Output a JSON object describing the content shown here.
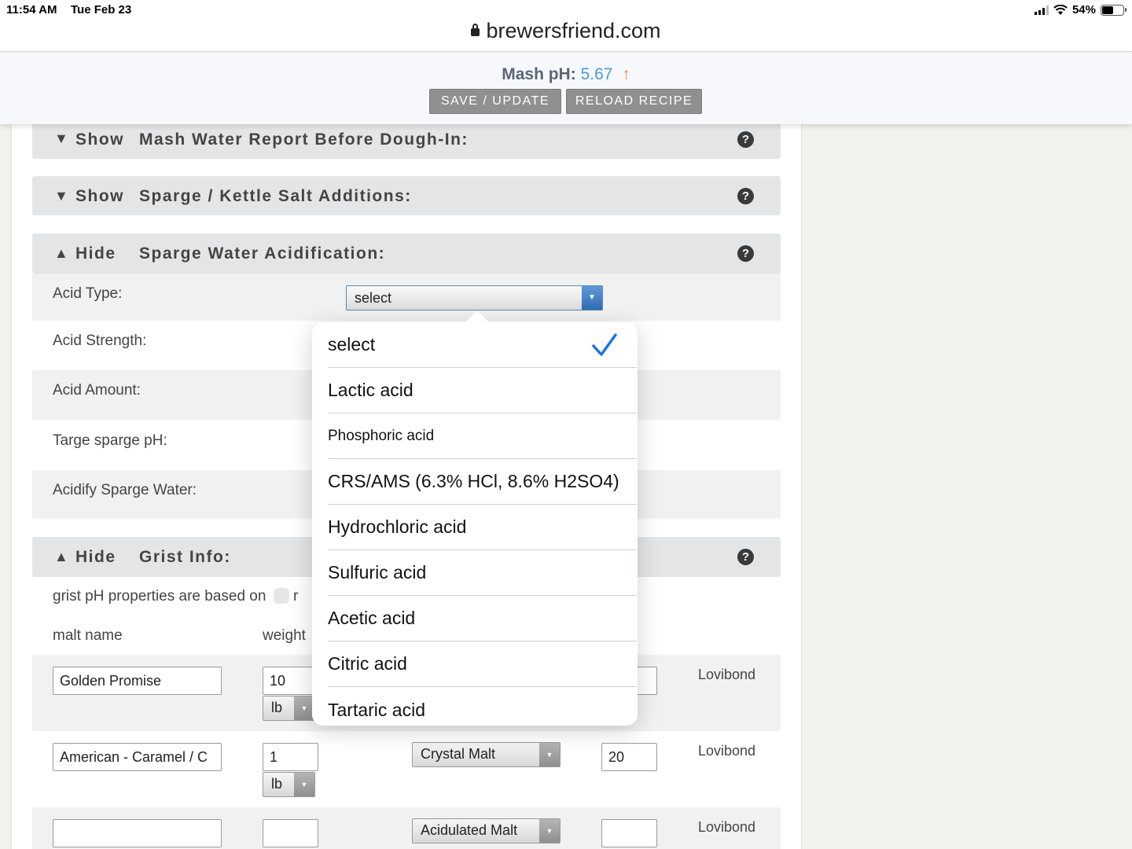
{
  "status_bar": {
    "time": "11:54 AM",
    "date": "Tue Feb 23",
    "battery": "54%"
  },
  "browser": {
    "url": "brewersfriend.com"
  },
  "header": {
    "mash_label": "Mash pH:",
    "mash_value": "5.67",
    "mash_arrow": "↑",
    "save_label": "SAVE / UPDATE",
    "reload_label": "RELOAD RECIPE"
  },
  "sections": {
    "mash_water": {
      "toggle": "Show",
      "title": "Mash Water Report Before Dough-In:"
    },
    "sparge_salt": {
      "toggle": "Show",
      "title": "Sparge / Kettle Salt Additions:"
    },
    "sparge_acid": {
      "toggle": "Hide",
      "title": "Sparge Water Acidification:"
    },
    "grist": {
      "toggle": "Hide",
      "title": "Grist Info:"
    }
  },
  "acidification": {
    "acid_type_label": "Acid Type:",
    "acid_type_value": "select",
    "acid_strength_label": "Acid Strength:",
    "acid_amount_label": "Acid Amount:",
    "target_ph_label": "Targe sparge pH:",
    "acidify_label": "Acidify Sparge Water:"
  },
  "dropdown": {
    "options": [
      {
        "label": "select",
        "selected": true
      },
      {
        "label": "Lactic acid"
      },
      {
        "label": "Phosphoric acid"
      },
      {
        "label": "CRS/AMS (6.3% HCl, 8.6% H2SO4)"
      },
      {
        "label": "Hydrochloric acid"
      },
      {
        "label": "Sulfuric acid"
      },
      {
        "label": "Acetic acid"
      },
      {
        "label": "Citric acid"
      },
      {
        "label": "Tartaric acid"
      }
    ]
  },
  "grist": {
    "note": "grist pH properties are based on",
    "note_tail": "r",
    "col_malt": "malt name",
    "col_weight": "weight",
    "color_unit": "Lovibond",
    "rows": [
      {
        "name": "Golden Promise",
        "weight": "10",
        "unit": "lb",
        "type": "",
        "color": ""
      },
      {
        "name": "American - Caramel / C",
        "weight": "1",
        "unit": "lb",
        "type": "Crystal Malt",
        "color": "20"
      },
      {
        "name": "",
        "weight": "",
        "unit": "",
        "type": "Acidulated Malt",
        "color": ""
      }
    ]
  },
  "colors": {
    "accent_blue": "#4a9ad8",
    "arrow_orange": "#f08a3c",
    "check_blue": "#1a73e8"
  }
}
